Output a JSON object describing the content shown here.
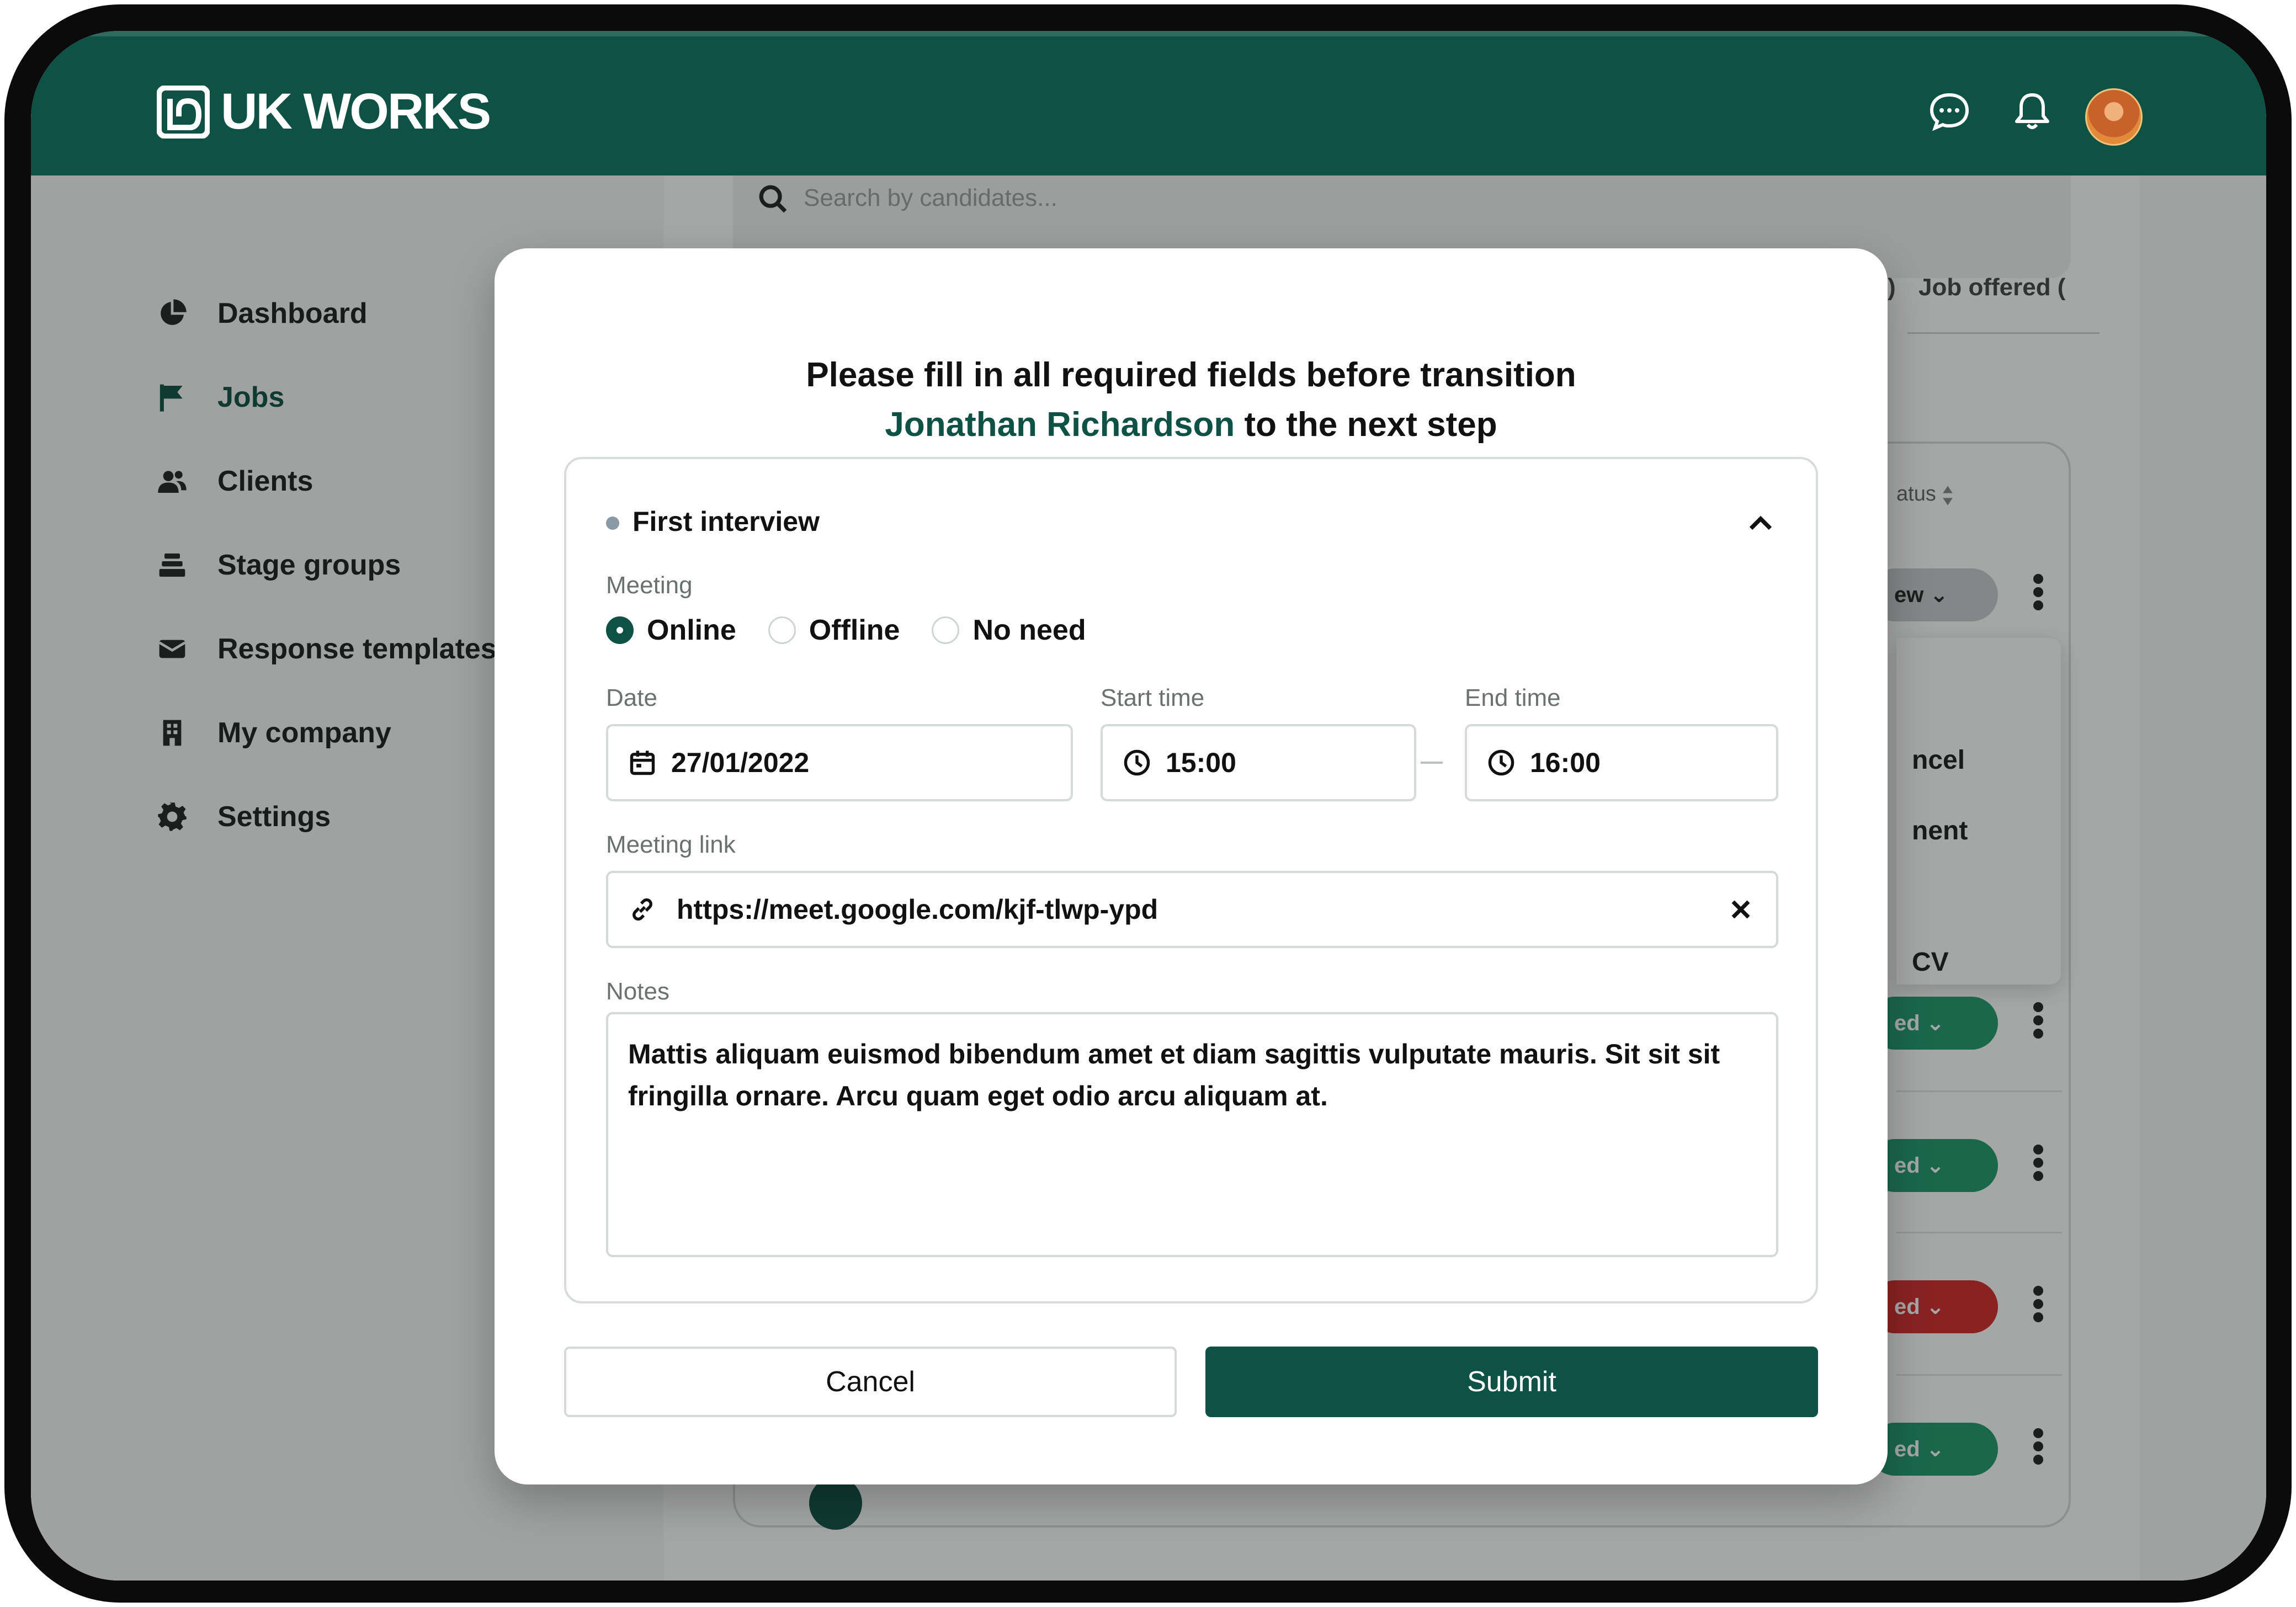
{
  "brand": {
    "name": "UK WORKS"
  },
  "header": {
    "icons": [
      "chat-icon",
      "bell-icon",
      "avatar"
    ]
  },
  "sidebar": {
    "items": [
      {
        "label": "Dashboard",
        "icon": "pie-chart-icon"
      },
      {
        "label": "Jobs",
        "icon": "flag-icon",
        "active": true
      },
      {
        "label": "Clients",
        "icon": "users-icon"
      },
      {
        "label": "Stage groups",
        "icon": "stack-icon"
      },
      {
        "label": "Response templates",
        "icon": "envelope-icon"
      },
      {
        "label": "My company",
        "icon": "building-icon"
      },
      {
        "label": "Settings",
        "icon": "gear-icon"
      }
    ]
  },
  "background": {
    "search_placeholder": "Search by candidates...",
    "tab_partial": "Job offered (",
    "tab_paren": ")",
    "status_header": "atus",
    "pills": [
      {
        "label": "ew",
        "color": "#c9cdcd"
      },
      {
        "label": "ed",
        "color": "#1f9a6f"
      },
      {
        "label": "ed",
        "color": "#1f9a6f"
      },
      {
        "label": "ed",
        "color": "#d42a2a"
      },
      {
        "label": "ed",
        "color": "#1f9a6f"
      }
    ],
    "menu_items": [
      "ncel",
      "nent",
      "CV"
    ]
  },
  "modal": {
    "title_line1": "Please fill in all required fields before transition",
    "candidate_name": "Jonathan Richardson",
    "title_line2_suffix": " to the next step",
    "section": {
      "title": "First interview",
      "meeting_label": "Meeting",
      "meeting_options": [
        "Online",
        "Offline",
        "No need"
      ],
      "meeting_selected": "Online",
      "date_label": "Date",
      "date_value": "27/01/2022",
      "start_label": "Start time",
      "start_value": "15:00",
      "end_label": "End time",
      "end_value": "16:00",
      "link_label": "Meeting link",
      "link_value": "https://meet.google.com/kjf-tlwp-ypd",
      "notes_label": "Notes",
      "notes_value": "Mattis aliquam euismod bibendum amet et diam sagittis vulputate mauris. Sit sit sit fringilla ornare. Arcu quam eget odio arcu aliquam at."
    },
    "cancel_label": "Cancel",
    "submit_label": "Submit"
  },
  "colors": {
    "brand": "#0e5145",
    "danger": "#d42a2a",
    "success": "#1f9a6f"
  }
}
